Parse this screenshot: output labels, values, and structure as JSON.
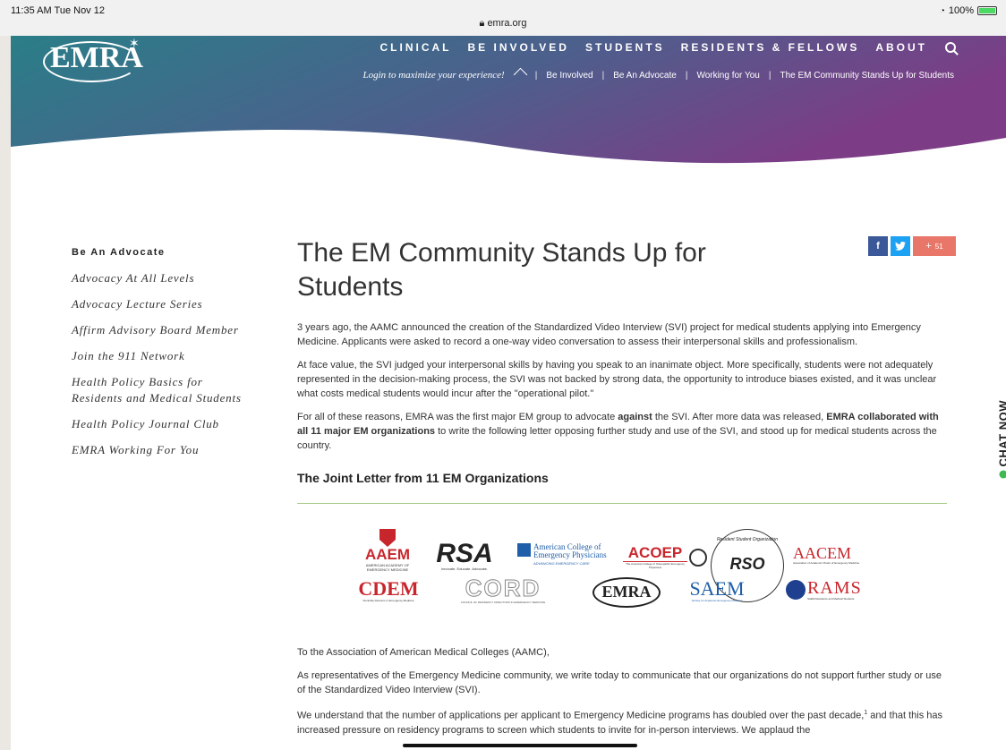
{
  "status_bar": {
    "time": "11:35 AM  Tue Nov 12",
    "url": "emra.org",
    "battery": "100%"
  },
  "header": {
    "logo": "EMRA",
    "nav": [
      "CLINICAL",
      "BE INVOLVED",
      "STUDENTS",
      "RESIDENTS & FELLOWS",
      "ABOUT"
    ],
    "login_text": "Login to maximize your experience!",
    "breadcrumbs": [
      "Be Involved",
      "Be An Advocate",
      "Working for You",
      "The EM Community Stands Up for Students"
    ]
  },
  "sidebar": {
    "heading": "Be An Advocate",
    "items": [
      "Advocacy At All Levels",
      "Advocacy Lecture Series",
      "Affirm Advisory Board Member",
      "Join the 911 Network",
      "Health Policy Basics for Residents and Medical Students",
      "Health Policy Journal Club",
      "EMRA Working For You"
    ]
  },
  "share": {
    "facebook": "f",
    "twitter": "t",
    "plus": "+",
    "count": "51"
  },
  "article": {
    "title": "The EM Community Stands Up for Students",
    "p1": "3 years ago, the AAMC announced the creation of the Standardized Video Interview (SVI) project for medical students applying into Emergency Medicine. Applicants were asked to record a one-way video conversation to assess their interpersonal skills and professionalism.",
    "p2": "At face value, the SVI judged your interpersonal skills by having you speak to an inanimate object. More specifically, students were not adequately represented in the decision-making process, the SVI was not backed by strong data, the opportunity to introduce biases existed, and it was unclear what costs medical students would incur after the \"operational pilot.\"",
    "p3_a": "For all of these reasons, EMRA was the first major EM group to advocate ",
    "p3_b": "against",
    "p3_c": " the SVI. After more data was released, ",
    "p3_d": "EMRA collaborated with all 11 major EM organizations",
    "p3_e": " to write the following letter opposing further study and use of the SVI, and stood up for medical students across the country.",
    "subheading": "The Joint Letter from 11 EM Organizations",
    "salutation": "To the Association of American Medical Colleges (AAMC),",
    "p4": "As representatives of the Emergency Medicine community, we write today to communicate that our organizations do not support further study or use of the Standardized Video Interview (SVI).",
    "p5": "We understand that the number of applications per applicant to Emergency Medicine programs has doubled over the past decade,",
    "p5_sup": "1",
    "p5_cont": "and that this has increased pressure on residency programs to screen which students to invite for in-person interviews. We applaud the"
  },
  "logos": {
    "aaem": "AAEM",
    "aaem_sub": "AMERICAN ACADEMY OF EMERGENCY MEDICINE",
    "rsa": "RSA",
    "rsa_sub": "Innovate. Educate. Advocate.",
    "acep": "American College of Emergency Physicians",
    "acep_sub": "ADVANCING EMERGENCY CARE",
    "acoep": "ACOEP",
    "acoep_sub": "The American College of Osteopathic Emergency Physicians",
    "rso": "RSO",
    "rso_arc": "Resident Student Organization",
    "aacem": "AACEM",
    "aacem_sub": "Association of Academic Chairs of Emergency Medicine",
    "cdem": "CDEM",
    "cdem_sub": "Clerkship Directors in Emergency Medicine",
    "cord": "CORD",
    "cord_sub": "COUNCIL OF RESIDENCY DIRECTORS IN EMERGENCY MEDICINE",
    "emra": "EMRA",
    "saem": "SAEM",
    "saem_sub": "Society for Academic Emergency Medicine",
    "rams": "RAMS",
    "rams_sub": "SAEM Residents and Medical Students"
  },
  "chat": {
    "label": "CHAT NOW"
  },
  "colors": {
    "hero_left": "#2e7a86",
    "hero_right": "#7a3f86",
    "share_fb": "#3b5998",
    "share_tw": "#1da1f2",
    "share_plus": "#e8776a",
    "rule": "#a8cc8a",
    "chat_dot": "#3fb950"
  }
}
